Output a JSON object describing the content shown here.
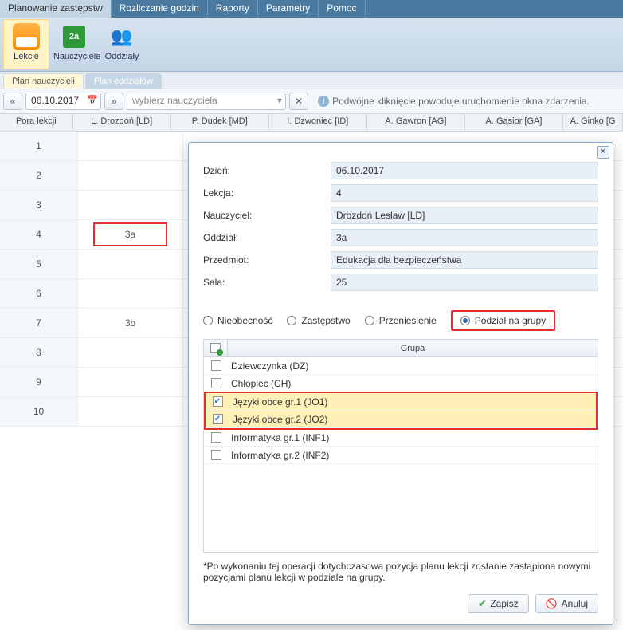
{
  "topTabs": [
    "Planowanie zastępstw",
    "Rozliczanie godzin",
    "Raporty",
    "Parametry",
    "Pomoc"
  ],
  "topTabActive": 0,
  "ribbon": [
    {
      "label": "Lekcje",
      "icon": "calendar"
    },
    {
      "label": "Nauczyciele",
      "icon": "green-2a"
    },
    {
      "label": "Oddziały",
      "icon": "person-2a"
    }
  ],
  "ribbonActive": 0,
  "planTabs": [
    "Plan nauczycieli",
    "Plan oddziałów"
  ],
  "planTabActive": 0,
  "toolbar": {
    "prev": "«",
    "next": "»",
    "date": "06.10.2017",
    "teacherCombo": "wybierz nauczyciela",
    "clearX": "✕",
    "infoText": "Podwójne kliknięcie powoduje uruchomienie okna zdarzenia."
  },
  "gridHeaders": [
    "Pora lekcji",
    "L. Drozdoń [LD]",
    "P. Dudek [MD]",
    "I. Dzwoniec [ID]",
    "A. Gawron [AG]",
    "A. Gąsior [GA]",
    "A. Ginko [G"
  ],
  "rows": [
    {
      "n": "1"
    },
    {
      "n": "2"
    },
    {
      "n": "3"
    },
    {
      "n": "4",
      "cell1": "3a",
      "box": true
    },
    {
      "n": "5"
    },
    {
      "n": "6"
    },
    {
      "n": "7",
      "cell1": "3b"
    },
    {
      "n": "8"
    },
    {
      "n": "9"
    },
    {
      "n": "10"
    }
  ],
  "modal": {
    "fields": [
      {
        "label": "Dzień:",
        "value": "06.10.2017"
      },
      {
        "label": "Lekcja:",
        "value": "4"
      },
      {
        "label": "Nauczyciel:",
        "value": "Drozdoń Lesław [LD]"
      },
      {
        "label": "Oddział:",
        "value": "3a"
      },
      {
        "label": "Przedmiot:",
        "value": "Edukacja dla bezpieczeństwa"
      },
      {
        "label": "Sala:",
        "value": "25"
      }
    ],
    "radios": [
      "Nieobecność",
      "Zastępstwo",
      "Przeniesienie",
      "Podział na grupy"
    ],
    "radioChecked": 3,
    "groupHeader": "Grupa",
    "groups": [
      {
        "name": "Dziewczynka (DZ)",
        "checked": false,
        "sel": false
      },
      {
        "name": "Chłopiec (CH)",
        "checked": false,
        "sel": false
      },
      {
        "name": "Języki obce gr.1 (JO1)",
        "checked": true,
        "sel": true
      },
      {
        "name": "Języki obce gr.2 (JO2)",
        "checked": true,
        "sel": true
      },
      {
        "name": "Informatyka gr.1 (INF1)",
        "checked": false,
        "sel": false
      },
      {
        "name": "Informatyka gr.2 (INF2)",
        "checked": false,
        "sel": false
      }
    ],
    "note": "*Po wykonaniu tej operacji dotychczasowa pozycja planu lekcji zostanie zastąpiona nowymi pozycjami planu lekcji w podziale na grupy.",
    "saveLabel": "Zapisz",
    "cancelLabel": "Anuluj"
  }
}
